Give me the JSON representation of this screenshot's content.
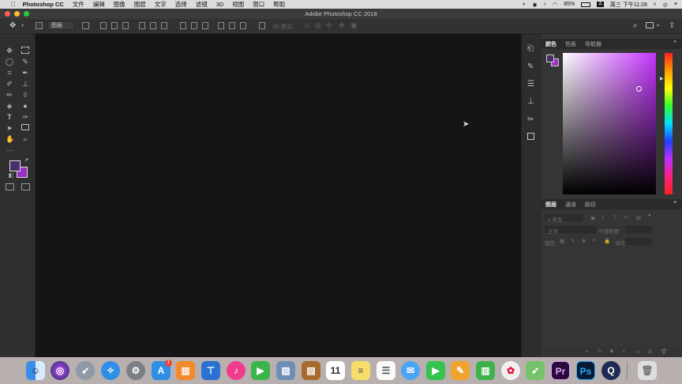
{
  "menubar": {
    "apple": "",
    "app": "Photoshop CC",
    "items": [
      "文件",
      "编辑",
      "图像",
      "图层",
      "文字",
      "选择",
      "滤镜",
      "3D",
      "视图",
      "窗口",
      "帮助"
    ],
    "battery": "85%",
    "input_method": "A",
    "clock": "周三 下午11:28"
  },
  "window": {
    "title": "Adobe Photoshop CC 2018"
  },
  "options": {
    "layer_dropdown": "图层",
    "mode_3d": "3D 模式:"
  },
  "color_panel": {
    "tabs": [
      "颜色",
      "色板",
      "导航器"
    ],
    "hue_colors": [
      "#ff2020",
      "#ff9a00",
      "#ffff00",
      "#30ff30",
      "#00e0ff",
      "#2040ff",
      "#c030ff",
      "#ff2080",
      "#ff2020"
    ],
    "fg": "#4a2e6b",
    "bg": "#9b2fc7"
  },
  "layers_panel": {
    "tabs": [
      "图层",
      "通道",
      "路径"
    ],
    "kind": "ρ 类型",
    "blend": "正常",
    "opacity_label": "不透明度:",
    "lock_label": "锁定:",
    "fill_label": "填充:"
  },
  "dock": {
    "calendar_day": "11",
    "appstore_badge": "1",
    "pr": "Pr",
    "ps": "Ps"
  }
}
